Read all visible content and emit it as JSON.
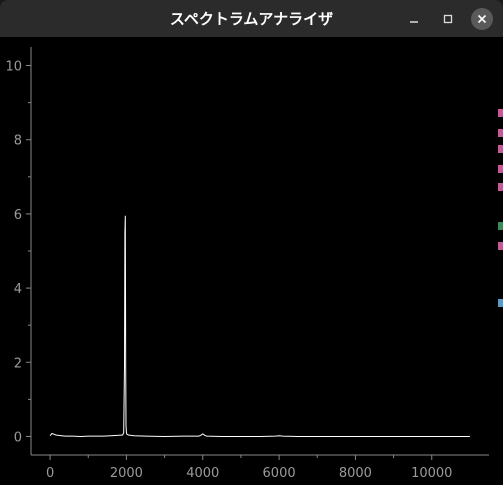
{
  "window": {
    "title": "スペクトラムアナライザ",
    "controls": {
      "minimize": "minimize-icon",
      "maximize": "maximize-icon",
      "close": "close-icon"
    }
  },
  "chart_data": {
    "type": "line",
    "title": "",
    "xlabel": "",
    "ylabel": "",
    "xlim": [
      -500,
      11500
    ],
    "ylim": [
      -0.5,
      10.5
    ],
    "x_ticks": [
      0,
      2000,
      4000,
      6000,
      8000,
      10000
    ],
    "y_ticks": [
      0,
      2,
      4,
      6,
      8,
      10
    ],
    "x_tick_labels": [
      "0",
      "2000",
      "4000",
      "6000",
      "8000",
      "10000"
    ],
    "y_tick_labels": [
      "0",
      "2",
      "4",
      "6",
      "8",
      "10"
    ],
    "grid": false,
    "background": "#000000",
    "axis_color": "#888888",
    "line_color": "#ffffff",
    "series": [
      {
        "x": [
          0,
          50,
          100,
          150,
          200,
          300,
          400,
          600,
          800,
          1000,
          1200,
          1400,
          1600,
          1800,
          1900,
          1930,
          1950,
          1960,
          1970,
          1980,
          1990,
          2000,
          2010,
          2030,
          2050,
          2100,
          2200,
          2500,
          3000,
          3500,
          3900,
          3950,
          4000,
          4050,
          4100,
          4500,
          5000,
          5500,
          5900,
          6000,
          6100,
          6500,
          7000,
          7500,
          8000,
          8500,
          9000,
          9500,
          10000,
          10500,
          11000
        ],
        "y": [
          0.02,
          0.08,
          0.06,
          0.04,
          0.03,
          0.02,
          0.01,
          0.01,
          0.0,
          0.01,
          0.01,
          0.01,
          0.02,
          0.03,
          0.04,
          0.1,
          1.9,
          5.5,
          5.95,
          1.95,
          0.3,
          0.12,
          0.06,
          0.05,
          0.04,
          0.03,
          0.02,
          0.01,
          0.0,
          0.01,
          0.01,
          0.03,
          0.07,
          0.03,
          0.01,
          0.0,
          0.0,
          0.0,
          0.01,
          0.02,
          0.01,
          0.0,
          0.0,
          0.0,
          0.0,
          0.0,
          0.0,
          0.0,
          0.0,
          0.0,
          0.0
        ]
      }
    ]
  },
  "edge_marks": [
    {
      "color": "#c8589a"
    },
    {
      "color": "#c8589a"
    },
    {
      "color": "#c8589a"
    },
    {
      "color": "#c8589a"
    },
    {
      "color": "#c8589a"
    },
    {
      "color": "#3c8c5a"
    },
    {
      "color": "#c8589a"
    },
    {
      "color": "#5a9ac8"
    }
  ]
}
